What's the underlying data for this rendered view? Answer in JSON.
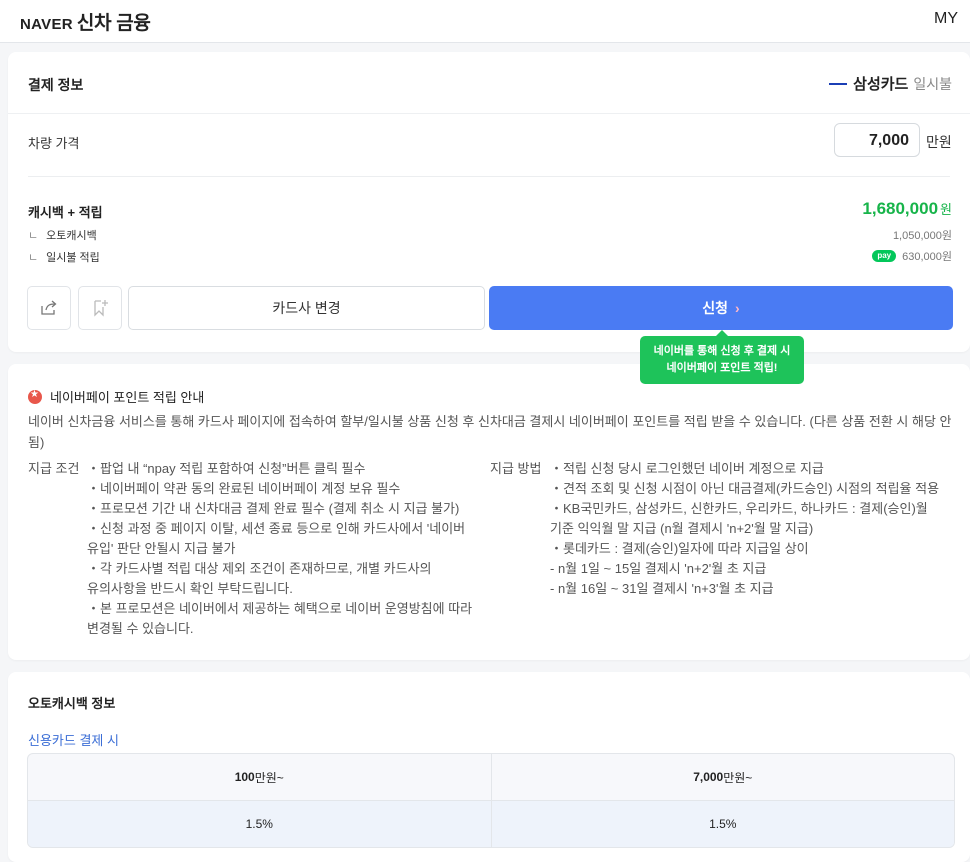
{
  "header": {
    "brand": "NAVER",
    "title": "신차 금융",
    "my": "MY"
  },
  "payment": {
    "title": "결제 정보",
    "card_name": "삼성카드",
    "pay_type": "일시불",
    "price_label": "차량 가격",
    "price_value": "7,000",
    "price_unit": "만원",
    "cashback_title": "캐시백 + 적립",
    "cashback_total": "1,680,000",
    "cashback_unit": "원",
    "auto_cashback_label": "오토캐시백",
    "auto_cashback_amount": "1,050,000원",
    "lumpsum_label": "일시불 적립",
    "lumpsum_badge": "pay",
    "lumpsum_amount": "630,000원",
    "change_card_label": "카드사 변경",
    "apply_label": "신청",
    "tooltip_line1": "네이버를 통해 신청 후 결제 시",
    "tooltip_line2": "네이버페이 포인트 적립!"
  },
  "guide": {
    "title": "네이버페이 포인트 적립 안내",
    "desc": "네이버 신차금융 서비스를 통해 카드사 페이지에 접속하여 할부/일시불 상품 신청 후 신차대금 결제시 네이버페이 포인트를 적립 받을 수 있습니다. (다른 상품 전환 시 해당 안됨)",
    "cond_label": "지급 조건",
    "cond_items": [
      "・팝업 내 “npay 적립 포함하여 신청”버튼 클릭 필수",
      "・네이버페이 약관 동의 완료된 네이버페이 계정 보유 필수",
      "・프로모션 기간 내 신차대금 결제 완료 필수 (결제 취소 시 지급 불가)",
      "・신청 과정 중 페이지 이탈, 세션 종료 등으로 인해 카드사에서 '네이버",
      "유입' 판단 안될시 지급 불가",
      "・각 카드사별 적립 대상 제외 조건이 존재하므로, 개별 카드사의",
      "유의사항을 반드시 확인 부탁드립니다.",
      "・본 프로모션은 네이버에서 제공하는 혜택으로 네이버 운영방침에 따라",
      "변경될 수 있습니다."
    ],
    "method_label": "지급 방법",
    "method_items": [
      "・적립 신청 당시 로그인했던 네이버 계정으로 지급",
      "・견적 조회 및 신청 시점이 아닌 대금결제(카드승인) 시점의 적립율 적용",
      "・KB국민카드, 삼성카드, 신한카드, 우리카드, 하나카드 : 결제(승인)월",
      "기준 익익월 말 지급 (n월 결제시 'n+2'월 말 지급)",
      "・롯데카드 : 결제(승인)일자에 따라 지급일 상이",
      "- n월 1일 ~ 15일 결제시 'n+2'월 초 지급",
      "- n월 16일 ~ 31일 결제시 'n+3'월 초 지급"
    ]
  },
  "auto_cashback": {
    "title": "오토캐시백 정보",
    "subtitle": "신용카드 결제 시",
    "headers": [
      {
        "num": "100",
        "unit": "만원~"
      },
      {
        "num": "7,000",
        "unit": "만원~"
      }
    ],
    "rates": [
      "1.5%",
      "1.5%"
    ]
  }
}
